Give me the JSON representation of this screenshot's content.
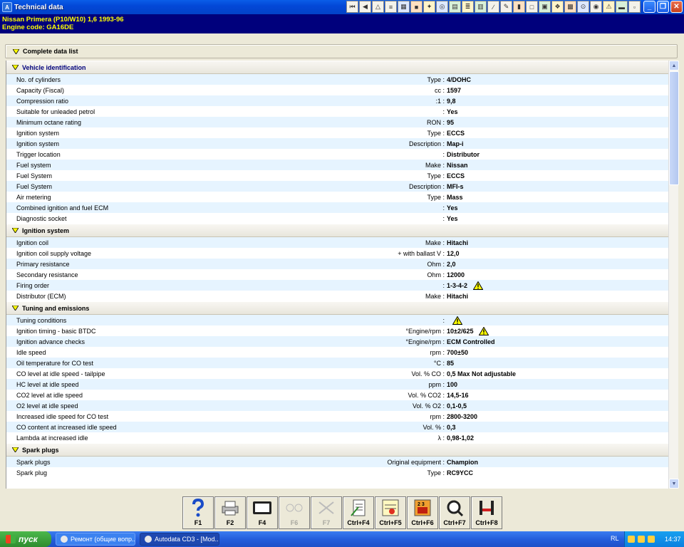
{
  "window": {
    "title": "Technical data"
  },
  "vehicle": {
    "line1": "Nissan   Primera (P10/W10) 1,6   1993-96",
    "line2": "Engine code: GA16DE"
  },
  "header": {
    "complete_list": "Complete data list"
  },
  "sections": [
    {
      "title": "Vehicle identification",
      "rows": [
        {
          "label": "No. of cylinders",
          "unit": "Type :",
          "value": "4/DOHC"
        },
        {
          "label": "Capacity (Fiscal)",
          "unit": "cc :",
          "value": "1597"
        },
        {
          "label": "Compression ratio",
          "unit": ":1 :",
          "value": "9,8"
        },
        {
          "label": "Suitable for unleaded petrol",
          "unit": ":",
          "value": "Yes"
        },
        {
          "label": "Minimum octane rating",
          "unit": "RON :",
          "value": "95"
        },
        {
          "label": "Ignition system",
          "unit": "Type :",
          "value": "ECCS"
        },
        {
          "label": "Ignition system",
          "unit": "Description :",
          "value": "Map-i"
        },
        {
          "label": "Trigger location",
          "unit": ":",
          "value": "Distributor"
        },
        {
          "label": "Fuel system",
          "unit": "Make :",
          "value": "Nissan"
        },
        {
          "label": "Fuel System",
          "unit": "Type :",
          "value": "ECCS"
        },
        {
          "label": "Fuel System",
          "unit": "Description :",
          "value": "MFI-s"
        },
        {
          "label": "Air metering",
          "unit": "Type :",
          "value": "Mass"
        },
        {
          "label": "Combined ignition and fuel ECM",
          "unit": ":",
          "value": "Yes"
        },
        {
          "label": "Diagnostic socket",
          "unit": ":",
          "value": "Yes"
        }
      ]
    },
    {
      "title": "Ignition system",
      "rows": [
        {
          "label": "Ignition coil",
          "unit": "Make :",
          "value": "Hitachi"
        },
        {
          "label": "Ignition coil supply voltage",
          "unit": "+ with ballast  V :",
          "value": "12,0"
        },
        {
          "label": "Primary resistance",
          "unit": "Ohm :",
          "value": "2,0"
        },
        {
          "label": "Secondary resistance",
          "unit": "Ohm :",
          "value": "12000"
        },
        {
          "label": "Firing order",
          "unit": ":",
          "value": "1-3-4-2",
          "warn": true
        },
        {
          "label": "Distributor (ECM)",
          "unit": "Make :",
          "value": "Hitachi"
        }
      ]
    },
    {
      "title": "Tuning and emissions",
      "rows": [
        {
          "label": "Tuning conditions",
          "unit": ":",
          "value": "",
          "warn": true
        },
        {
          "label": "Ignition timing - basic  BTDC",
          "unit": "°Engine/rpm :",
          "value": "10±2/625",
          "warn": true
        },
        {
          "label": "Ignition advance checks",
          "unit": "°Engine/rpm :",
          "value": "ECM Controlled"
        },
        {
          "label": "Idle speed",
          "unit": "rpm :",
          "value": "700±50"
        },
        {
          "label": "Oil temperature for CO test",
          "unit": "°C :",
          "value": "85"
        },
        {
          "label": "CO level at idle speed - tailpipe",
          "unit": "Vol. % CO :",
          "value": "0,5 Max Not adjustable"
        },
        {
          "label": "HC level at idle speed",
          "unit": "ppm :",
          "value": "100"
        },
        {
          "label": "CO2 level at idle speed",
          "unit": "Vol. % CO2 :",
          "value": "14,5-16"
        },
        {
          "label": "O2 level at idle speed",
          "unit": "Vol. % O2 :",
          "value": "0,1-0,5"
        },
        {
          "label": "Increased idle speed for CO test",
          "unit": "rpm :",
          "value": "2800-3200"
        },
        {
          "label": "CO content at increased idle speed",
          "unit": "Vol. % :",
          "value": "0,3"
        },
        {
          "label": "Lambda at increased idle",
          "unit": "λ :",
          "value": "0,98-1,02"
        }
      ]
    },
    {
      "title": "Spark plugs",
      "rows": [
        {
          "label": "Spark plugs",
          "unit": "Original equipment :",
          "value": "Champion"
        },
        {
          "label": "Spark plug",
          "unit": "Type :",
          "value": "RC9YCC"
        }
      ]
    }
  ],
  "fkeys": [
    {
      "key": "F1",
      "icon": "help-icon",
      "enabled": true
    },
    {
      "key": "F2",
      "icon": "print-icon",
      "enabled": true
    },
    {
      "key": "F4",
      "icon": "screen-icon",
      "enabled": true
    },
    {
      "key": "F6",
      "icon": "diagram-icon",
      "enabled": false
    },
    {
      "key": "F7",
      "icon": "tools-icon",
      "enabled": false
    },
    {
      "key": "Ctrl+F4",
      "icon": "notes-icon",
      "enabled": true
    },
    {
      "key": "Ctrl+F5",
      "icon": "calculator-icon",
      "enabled": true
    },
    {
      "key": "Ctrl+F6",
      "icon": "engine-icon",
      "enabled": true
    },
    {
      "key": "Ctrl+F7",
      "icon": "search-icon",
      "enabled": true
    },
    {
      "key": "Ctrl+F8",
      "icon": "lift-icon",
      "enabled": true
    }
  ],
  "taskbar": {
    "start": "пуск",
    "tasks": [
      "Ремонт (общие вопр...",
      "Autodata CD3 - [Mod..."
    ],
    "lang": "RL",
    "clock": "14:37"
  }
}
